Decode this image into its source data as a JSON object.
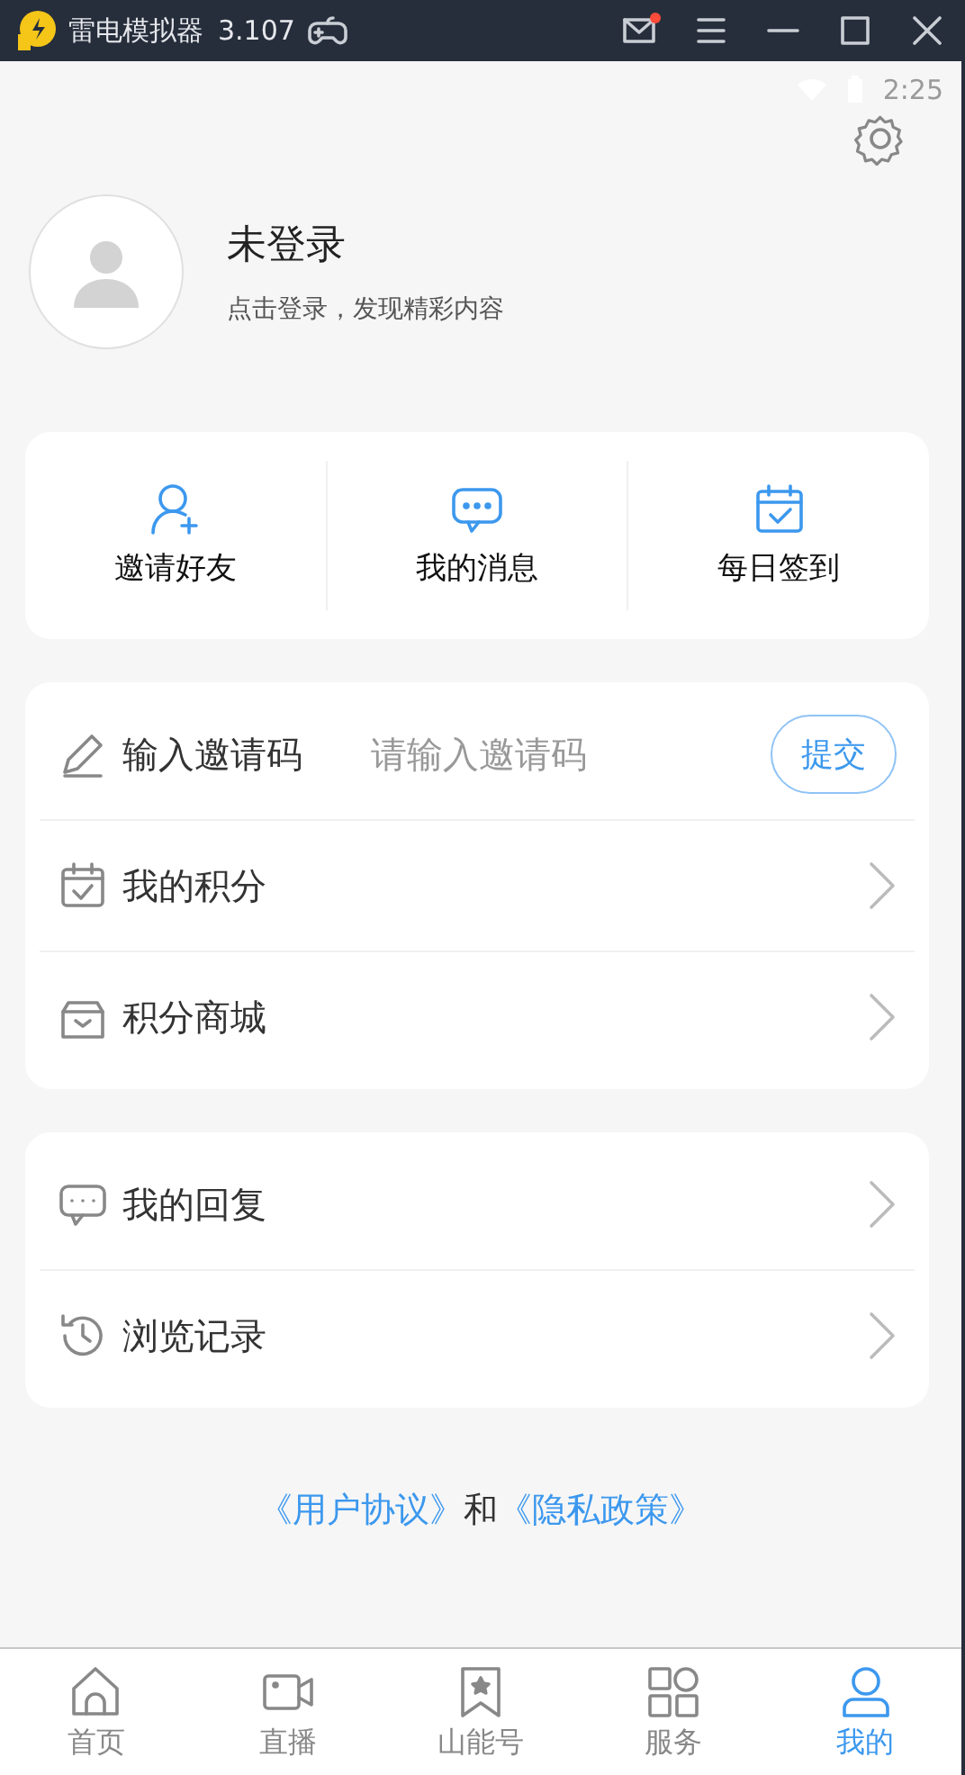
{
  "window": {
    "title": "雷电模拟器",
    "version": "3.107",
    "mail_unread": true
  },
  "status_bar": {
    "time": "2:25"
  },
  "profile": {
    "name": "未登录",
    "subtitle": "点击登录，发现精彩内容"
  },
  "quick_actions": [
    {
      "label": "邀请好友"
    },
    {
      "label": "我的消息"
    },
    {
      "label": "每日签到"
    }
  ],
  "invite": {
    "label": "输入邀请码",
    "placeholder": "请输入邀请码",
    "button": "提交"
  },
  "menu_groups": [
    {
      "rows": [
        {
          "label": "我的积分"
        },
        {
          "label": "积分商城"
        }
      ]
    },
    {
      "rows": [
        {
          "label": "我的回复"
        },
        {
          "label": "浏览记录"
        }
      ]
    }
  ],
  "footer": {
    "link_1": "《用户协议》",
    "joiner": "和",
    "link_2": "《隐私政策》"
  },
  "tabs": [
    {
      "label": "首页",
      "selected": false
    },
    {
      "label": "直播",
      "selected": false
    },
    {
      "label": "山能号",
      "selected": false
    },
    {
      "label": "服务",
      "selected": false
    },
    {
      "label": "我的",
      "selected": true
    }
  ]
}
